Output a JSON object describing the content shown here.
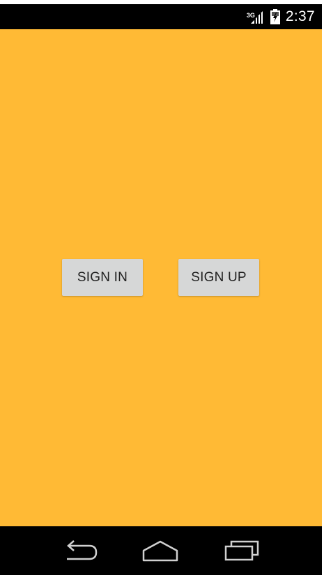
{
  "status_bar": {
    "network_type": "3G",
    "time": "2:37",
    "icons": [
      "signal-icon",
      "battery-icon"
    ]
  },
  "main": {
    "background_color": "#FFBA35",
    "sign_in_label": "SIGN IN",
    "sign_up_label": "SIGN UP"
  },
  "nav_bar": {
    "icons": [
      "back-icon",
      "home-icon",
      "recents-icon"
    ]
  }
}
